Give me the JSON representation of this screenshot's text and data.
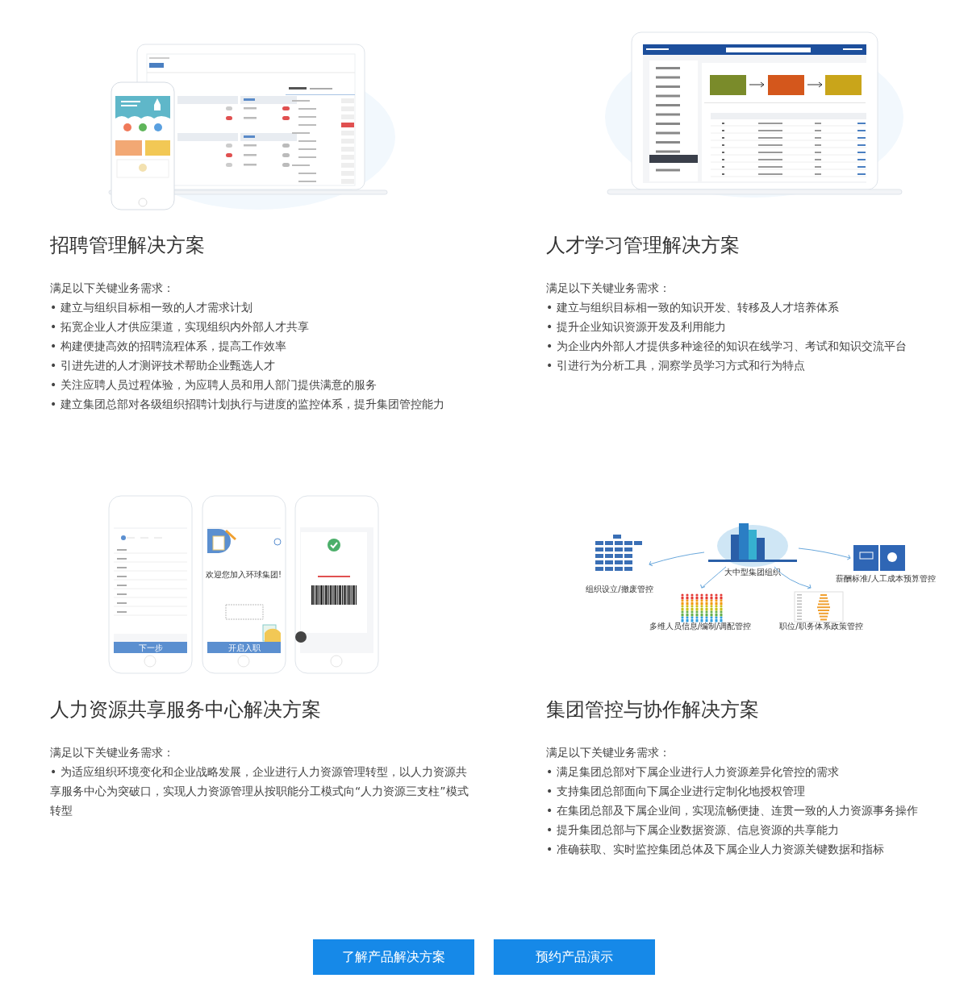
{
  "sections": [
    {
      "art": {
        "kind": "laptop_phone"
      },
      "title": "招聘管理解决方案",
      "intro": "满足以下关键业务需求：",
      "bullets": [
        "• 建立与组织目标相一致的人才需求计划",
        "• 拓宽企业人才供应渠道，实现组织内外部人才共享",
        "• 构建便捷高效的招聘流程体系，提高工作效率",
        "• 引进先进的人才测评技术帮助企业甄选人才",
        "• 关注应聘人员过程体验，为应聘人员和用人部门提供满意的服务",
        "• 建立集团总部对各级组织招聘计划执行与进度的监控体系，提升集团管控能力"
      ]
    },
    {
      "art": {
        "kind": "laptop"
      },
      "title": "人才学习管理解决方案",
      "intro": "满足以下关键业务需求：",
      "bullets": [
        "• 建立与组织目标相一致的知识开发、转移及人才培养体系",
        "• 提升企业知识资源开发及利用能力",
        "• 为企业内外部人才提供多种途径的知识在线学习、考试和知识交流平台",
        "• 引进行为分析工具，洞察学员学习方式和行为特点"
      ]
    },
    {
      "art": {
        "kind": "phones",
        "welcome": "欢迎您加入环球集团!",
        "phone_buttons": [
          "下一步",
          "开启入职"
        ]
      },
      "title": "人力资源共享服务中心解决方案",
      "intro": "满足以下关键业务需求：",
      "bullets": [
        "• 为适应组织环境变化和企业战略发展，企业进行人力资源管理转型，以人力资源共享服务中心为突破口，实现人力资源管理从按职能分工模式向“人力资源三支柱”模式转型"
      ]
    },
    {
      "art": {
        "kind": "diagram",
        "center": "大中型集团组织",
        "nodes": [
          "组织设立/撤废管控",
          "多维人员信息/编制/调配管控",
          "职位/职务体系政策管控",
          "薪酬标准/人工成本预算管控"
        ]
      },
      "title": "集团管控与协作解决方案",
      "intro": "满足以下关键业务需求：",
      "bullets": [
        "• 满足集团总部对下属企业进行人力资源差异化管控的需求",
        "• 支持集团总部面向下属企业进行定制化地授权管理",
        "• 在集团总部及下属企业间，实现流畅便捷、连贯一致的人力资源事务操作",
        "• 提升集团总部与下属企业数据资源、信息资源的共享能力",
        "• 准确获取、实时监控集团总体及下属企业人力资源关键数据和指标"
      ]
    }
  ],
  "buttons": [
    "了解产品解决方案",
    "预约产品演示"
  ]
}
